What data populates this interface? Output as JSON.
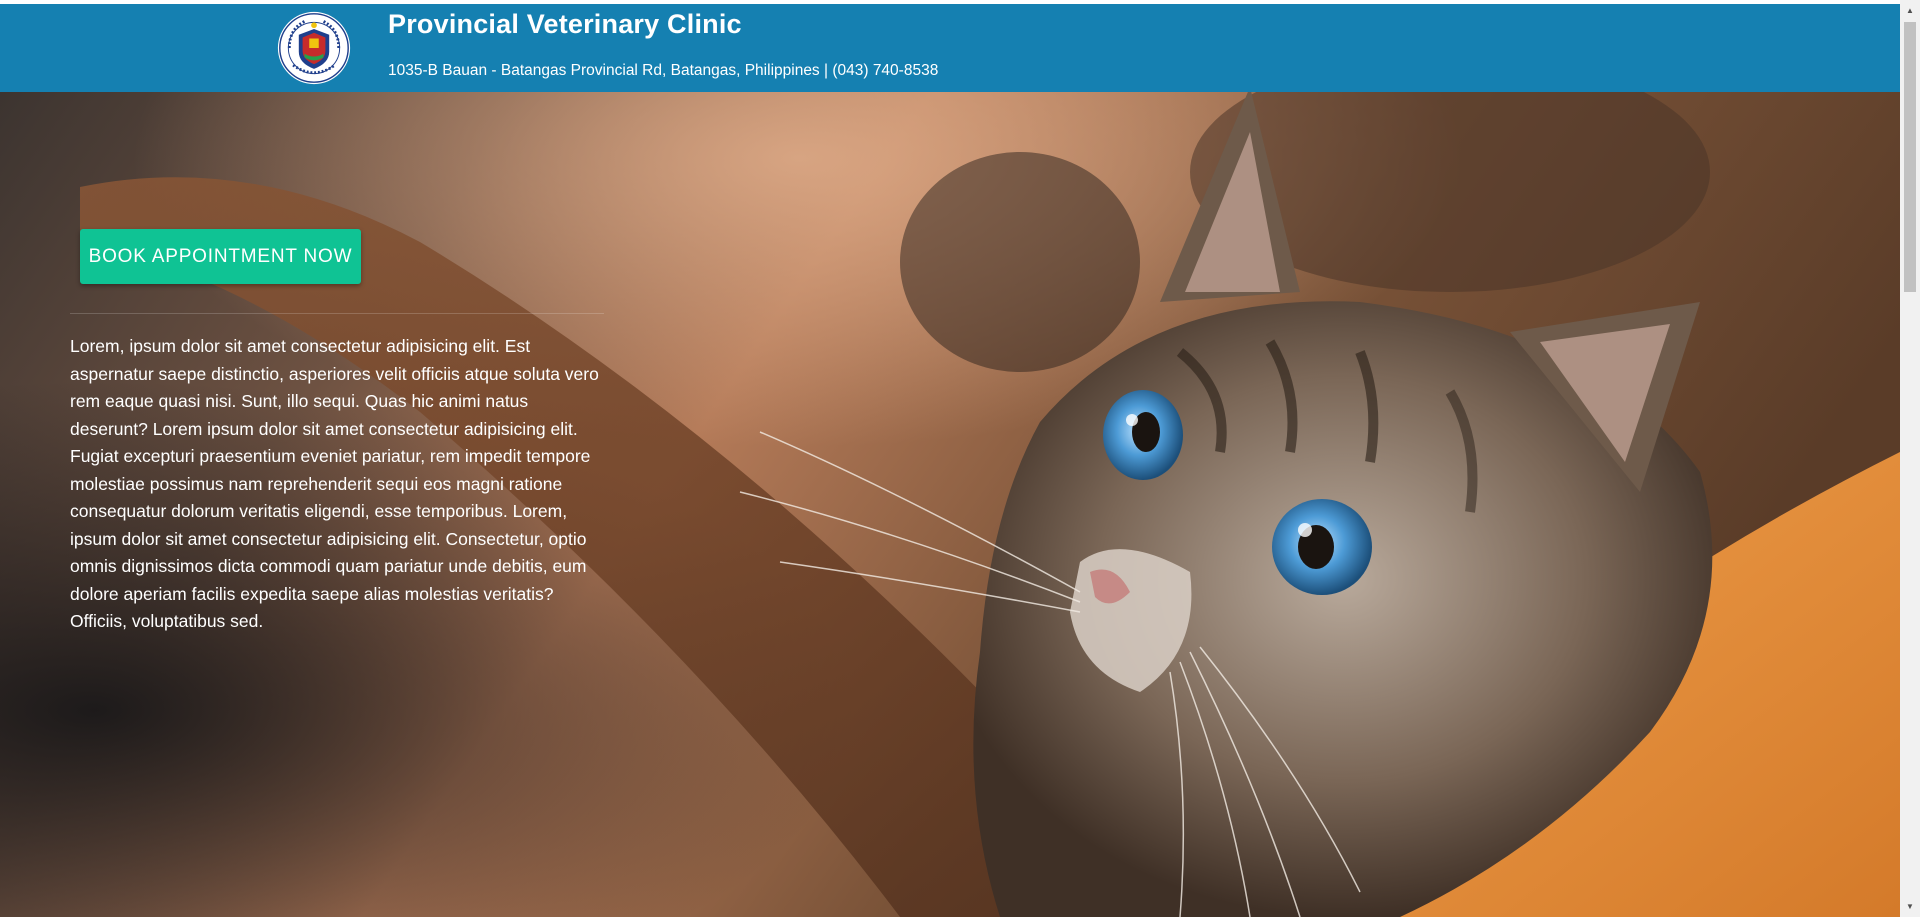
{
  "header": {
    "title": "Provincial Veterinary Clinic",
    "address": "1035-B Bauan - Batangas Provincial Rd, Batangas, Philippines | (043) 740-8538",
    "background_color": "#1580b1",
    "logo_text": "PAMAHALAANG PANLALAWIGAN NG BATANGAS PILIPINAS"
  },
  "hero": {
    "image": "tabby-cat-peeking-over-wooden-surface",
    "cta_label": "BOOK APPOINTMENT NOW",
    "cta_color": "#0fc394",
    "body_text": "Lorem, ipsum dolor sit amet consectetur adipisicing elit. Est aspernatur saepe distinctio, asperiores velit officiis atque soluta vero rem eaque quasi nisi. Sunt, illo sequi. Quas hic animi natus deserunt? Lorem ipsum dolor sit amet consectetur adipisicing elit. Fugiat excepturi praesentium eveniet pariatur, rem impedit tempore molestiae possimus nam reprehenderit sequi eos magni ratione consequatur dolorum veritatis eligendi, esse temporibus. Lorem, ipsum dolor sit amet consectetur adipisicing elit. Consectetur, optio omnis dignissimos dicta commodi quam pariatur unde debitis, eum dolore aperiam facilis expedita saepe alias molestias veritatis? Officiis, voluptatibus sed."
  },
  "scrollbar": {
    "up_icon": "triangle-up-icon",
    "down_icon": "triangle-down-icon",
    "up_glyph": "▲",
    "down_glyph": "▼"
  }
}
